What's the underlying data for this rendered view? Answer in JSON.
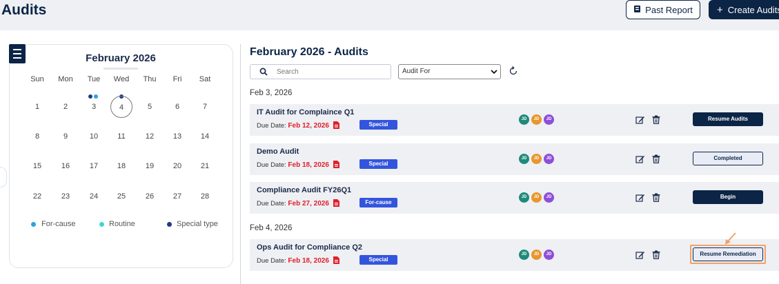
{
  "header": {
    "title": "Audits",
    "past_report_label": "Past Report",
    "create_label": "Create Audits"
  },
  "calendar": {
    "month_label": "February 2026",
    "weekdays": [
      "Sun",
      "Mon",
      "Tue",
      "Wed",
      "Thu",
      "Fri",
      "Sat"
    ],
    "weeks": [
      [
        "1",
        "2",
        "3",
        "4",
        "5",
        "6",
        "7"
      ],
      [
        "8",
        "9",
        "10",
        "11",
        "12",
        "13",
        "14"
      ],
      [
        "15",
        "16",
        "17",
        "18",
        "19",
        "20",
        "21"
      ],
      [
        "22",
        "23",
        "24",
        "25",
        "26",
        "27",
        "28"
      ]
    ],
    "selected_day": "4",
    "legend": [
      {
        "label": "For-cause",
        "color": "#29a3e0"
      },
      {
        "label": "Routine",
        "color": "#3dd6d6"
      },
      {
        "label": "Special type",
        "color": "#1e3a8a"
      }
    ]
  },
  "audits": {
    "title": "February 2026 - Audits",
    "search_placeholder": "Search",
    "filter_value": "Audit For",
    "due_prefix": "Due Date:",
    "groups": [
      {
        "date": "Feb 3, 2026",
        "items": [
          {
            "title": "IT Audit for Complaince Q1",
            "due": "Feb 12, 2026",
            "tag": "Special",
            "avatars": [
              "JD",
              "JD",
              "JD"
            ],
            "action": "Resume Audits"
          },
          {
            "title": "Demo Audit",
            "due": "Feb 18, 2026",
            "tag": "Special",
            "avatars": [
              "JD",
              "JD",
              "JD"
            ],
            "action": "Completed"
          },
          {
            "title": "Compliance Audit FY26Q1",
            "due": "Feb 27, 2026",
            "tag": "For-cause",
            "avatars": [
              "JD",
              "JD",
              "JD"
            ],
            "action": "Begin"
          }
        ]
      },
      {
        "date": "Feb 4, 2026",
        "items": [
          {
            "title": "Ops Audit for Compliance Q2",
            "due": "Feb 18, 2026",
            "tag": "Special",
            "avatars": [
              "JD",
              "JD",
              "JD"
            ],
            "action": "Resume Remediation"
          }
        ]
      }
    ]
  },
  "colors": {
    "primary": "#0c2546",
    "due_red": "#e0202a",
    "tag_blue": "#3355dd",
    "avatar_teal": "#1f8a7a",
    "avatar_orange": "#e8962e",
    "avatar_purple": "#8d4fd8",
    "highlight": "#f2a06a"
  },
  "icons": [
    "menu-icon",
    "search-icon",
    "chevron-down-icon",
    "refresh-icon",
    "pdf-icon",
    "edit-icon",
    "trash-icon",
    "report-icon",
    "plus-icon",
    "arrow-icon"
  ]
}
